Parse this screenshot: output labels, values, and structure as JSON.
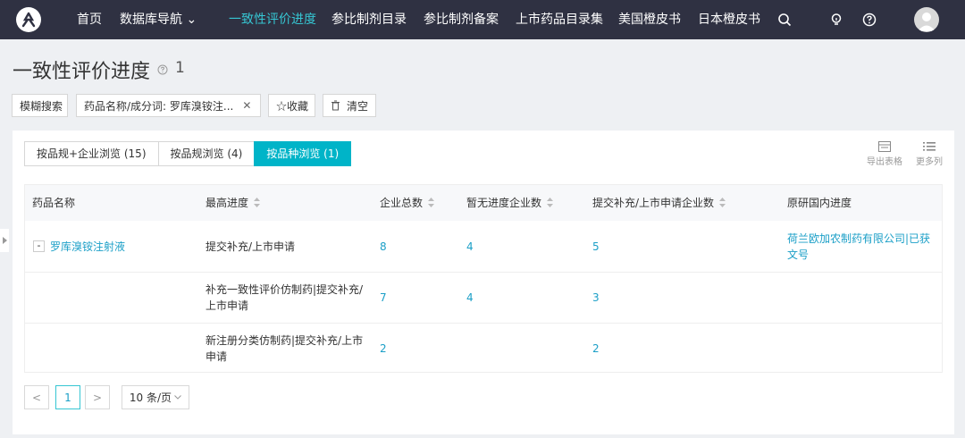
{
  "nav": {
    "items": [
      {
        "label": "首页"
      },
      {
        "label": "数据库导航 ⌄"
      },
      {
        "label": "一致性评价进度"
      },
      {
        "label": "参比制剂目录"
      },
      {
        "label": "参比制剂备案"
      },
      {
        "label": "上市药品目录集"
      },
      {
        "label": "美国橙皮书"
      },
      {
        "label": "日本橙皮书"
      }
    ],
    "icons": [
      "search-icon",
      "bulb-icon",
      "help-icon",
      "avatar"
    ]
  },
  "page": {
    "title": "一致性评价进度",
    "count": "1"
  },
  "filters": {
    "fuzzy_search": "模糊搜索",
    "drug_tag": "药品名称/成分词:  罗库溴铵注...",
    "favorite": "☆收藏",
    "clear": "清空"
  },
  "tabs": [
    {
      "label": "按品规+企业浏览 (15)"
    },
    {
      "label": "按品规浏览 (4)"
    },
    {
      "label": "按品种浏览 (1)"
    }
  ],
  "tools": {
    "export": "导出表格",
    "more_cols": "更多列"
  },
  "table": {
    "headers": [
      "药品名称",
      "最高进度",
      "企业总数",
      "暂无进度企业数",
      "提交补充/上市申请企业数",
      "原研国内进度"
    ],
    "drug_name": "罗库溴铵注射液",
    "expander": "-",
    "original": "荷兰欧加农制药有限公司|已获文号",
    "rows": [
      {
        "progress": "提交补充/上市申请",
        "total": "8",
        "none": "4",
        "submitted": "5"
      },
      {
        "progress": "补充一致性评价仿制药|提交补充/上市申请",
        "total": "7",
        "none": "4",
        "submitted": "3"
      },
      {
        "progress": "新注册分类仿制药|提交补充/上市申请",
        "total": "2",
        "none": "",
        "submitted": "2"
      }
    ]
  },
  "pagination": {
    "prev": "<",
    "page": "1",
    "next": ">",
    "page_size": "10 条/页"
  },
  "colors": {
    "nav_bg": "#2f3142",
    "accent": "#36c6d3",
    "tab_active": "#00b4c8",
    "link": "#1b9fc7"
  }
}
